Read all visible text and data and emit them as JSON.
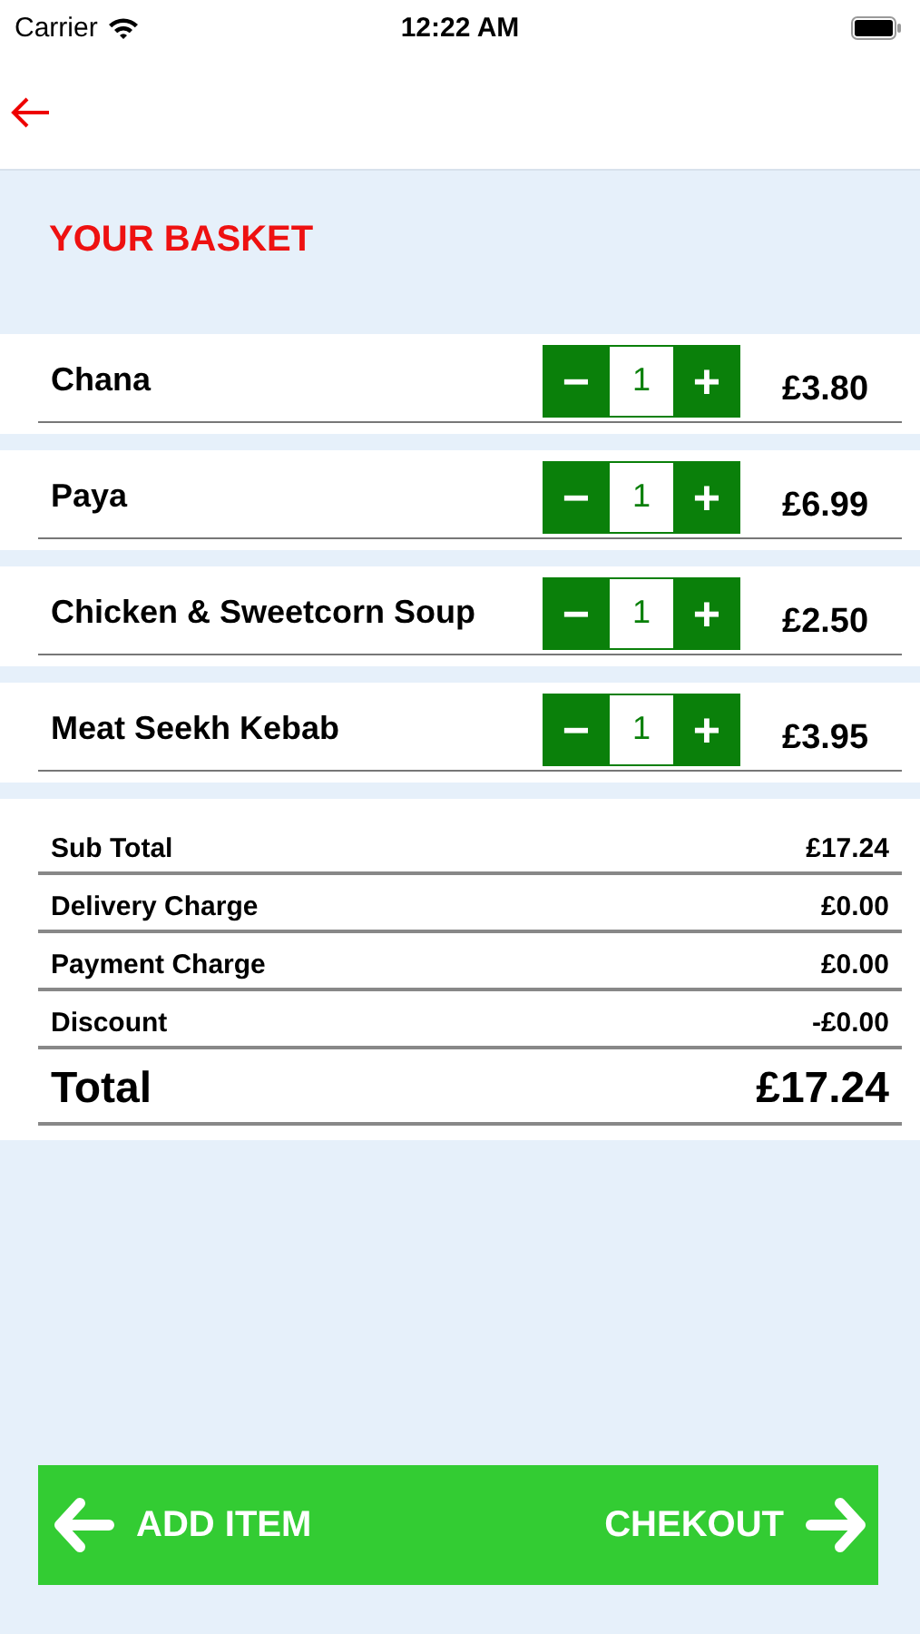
{
  "status_bar": {
    "carrier": "Carrier",
    "time": "12:22 AM"
  },
  "title": "YOUR BASKET",
  "items": [
    {
      "name": "Chana",
      "quantity": "1",
      "minus": "−",
      "plus": "+",
      "price": "£3.80"
    },
    {
      "name": "Paya",
      "quantity": "1",
      "minus": "−",
      "plus": "+",
      "price": "£6.99"
    },
    {
      "name": "Chicken & Sweetcorn Soup",
      "quantity": "1",
      "minus": "−",
      "plus": "+",
      "price": "£2.50"
    },
    {
      "name": "Meat Seekh Kebab",
      "quantity": "1",
      "minus": "−",
      "plus": "+",
      "price": "£3.95"
    }
  ],
  "summary": [
    {
      "kind": "line",
      "label": "Sub Total",
      "value": "£17.24"
    },
    {
      "kind": "line",
      "label": "Delivery Charge",
      "value": "£0.00"
    },
    {
      "kind": "line",
      "label": "Payment Charge",
      "value": "£0.00"
    },
    {
      "kind": "line",
      "label": "Discount",
      "value": "-£0.00"
    },
    {
      "kind": "total",
      "label": "Total",
      "value": "£17.24"
    }
  ],
  "footer": {
    "add_item": "ADD ITEM",
    "checkout": "CHEKOUT"
  }
}
